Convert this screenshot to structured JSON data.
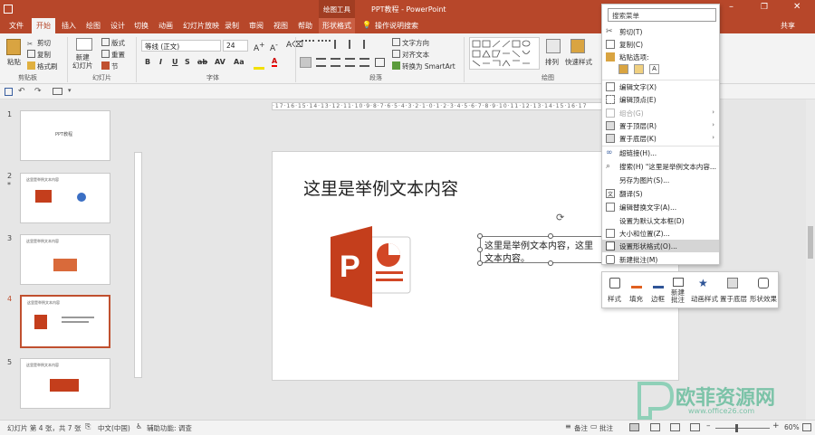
{
  "titlebar": {
    "drawing_tools": "绘图工具",
    "doc_title": "PPT教程 - PowerPoint",
    "help_search": "操作说明搜索",
    "share": "共享"
  },
  "tabs": [
    "文件",
    "开始",
    "插入",
    "绘图",
    "设计",
    "切换",
    "动画",
    "幻灯片放映",
    "录制",
    "审阅",
    "视图",
    "帮助",
    "形状格式"
  ],
  "ribbon": {
    "clipboard": {
      "paste": "粘贴",
      "cut": "剪切",
      "copy": "复制",
      "format_painter": "格式刷",
      "group": "剪贴板"
    },
    "slides": {
      "new_slide": "新建\n幻灯片",
      "layout": "版式",
      "reset": "重置",
      "section": "节",
      "group": "幻灯片"
    },
    "font": {
      "font_name": "等线 (正文)",
      "font_size": "24",
      "bold": "B",
      "italic": "I",
      "underline": "U",
      "strike": "S",
      "group": "字体"
    },
    "paragraph": {
      "text_direction": "文字方向",
      "align_text": "对齐文本",
      "smartart": "转换为 SmartArt",
      "group": "段落"
    },
    "drawing": {
      "arrange": "排列",
      "quick_styles": "快速样式",
      "group": "绘图"
    }
  },
  "slides_panel": [
    {
      "num": "1",
      "title": "PPT教程"
    },
    {
      "num": "2",
      "title": "这里是举例文本内容"
    },
    {
      "num": "3",
      "title": "这里是举例文本内容"
    },
    {
      "num": "4",
      "title": "这里是举例文本内容"
    },
    {
      "num": "5",
      "title": "这里是举例文本内容"
    }
  ],
  "slide": {
    "title": "这里是举例文本内容",
    "textbox_line1": "这里是举例文本内容，这里",
    "textbox_line2": "文本内容。"
  },
  "context_menu": {
    "search_placeholder": "搜索菜单",
    "items": [
      {
        "label": "剪切(T)",
        "icon": "scissors-icon",
        "disabled": false
      },
      {
        "label": "复制(C)",
        "icon": "copy-icon",
        "disabled": false
      },
      {
        "label": "粘贴选项:",
        "icon": "paste-icon",
        "disabled": false
      },
      {
        "label": "编辑文字(X)",
        "icon": "edit-text-icon",
        "disabled": false
      },
      {
        "label": "编辑顶点(E)",
        "icon": "edit-points-icon",
        "disabled": false
      },
      {
        "label": "组合(G)",
        "icon": "group-icon",
        "disabled": true
      },
      {
        "label": "置于顶层(R)",
        "icon": "bring-front-icon",
        "disabled": false
      },
      {
        "label": "置于底层(K)",
        "icon": "send-back-icon",
        "disabled": false
      },
      {
        "label": "超链接(H)...",
        "icon": "link-icon",
        "disabled": false
      },
      {
        "label": "搜索(H) \"这里是举例文本内容...",
        "icon": "search-icon",
        "disabled": false
      },
      {
        "label": "另存为图片(S)...",
        "icon": "",
        "disabled": false
      },
      {
        "label": "翻译(S)",
        "icon": "translate-icon",
        "disabled": false
      },
      {
        "label": "编辑替换文字(A)...",
        "icon": "alt-text-icon",
        "disabled": false
      },
      {
        "label": "设置为默认文本框(D)",
        "icon": "",
        "disabled": false
      },
      {
        "label": "大小和位置(Z)...",
        "icon": "size-position-icon",
        "disabled": false
      },
      {
        "label": "设置形状格式(O)...",
        "icon": "format-shape-icon",
        "disabled": false
      },
      {
        "label": "新建批注(M)",
        "icon": "comment-icon",
        "disabled": false
      }
    ]
  },
  "mini_toolbar": [
    "样式",
    "填充",
    "边框",
    "新建\n批注",
    "动画样式",
    "置于底层",
    "形状效果"
  ],
  "statusbar": {
    "slide_info": "幻灯片 第 4 张，共 7 张",
    "language": "中文(中国)",
    "accessibility": "辅助功能: 调查",
    "notes": "备注",
    "comments": "批注",
    "zoom": "60%"
  },
  "watermark": {
    "brand": "欧菲资源网",
    "url": "www.office26.com"
  },
  "colors": {
    "accent": "#b7472a",
    "selected_slide_border": "#c0502f",
    "ppt_logo": "#c43e1c"
  }
}
